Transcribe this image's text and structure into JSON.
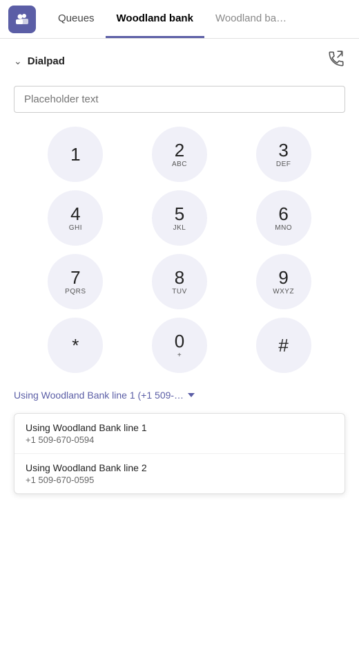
{
  "header": {
    "logo_alt": "Teams logo",
    "tabs": [
      {
        "label": "Queues",
        "active": false
      },
      {
        "label": "Woodland bank",
        "active": true
      },
      {
        "label": "Woodland ba…",
        "active": false,
        "truncated": true
      }
    ]
  },
  "dialpad": {
    "section_label": "Dialpad",
    "toggle_icon": "chevron-down-icon",
    "call_icon": "phone-icon",
    "input_placeholder": "Placeholder text",
    "buttons": [
      {
        "number": "1",
        "letters": ""
      },
      {
        "number": "2",
        "letters": "ABC"
      },
      {
        "number": "3",
        "letters": "DEF"
      },
      {
        "number": "4",
        "letters": "GHI"
      },
      {
        "number": "5",
        "letters": "JKL"
      },
      {
        "number": "6",
        "letters": "MNO"
      },
      {
        "number": "7",
        "letters": "PQRS"
      },
      {
        "number": "8",
        "letters": "TUV"
      },
      {
        "number": "9",
        "letters": "WXYZ"
      },
      {
        "number": "*",
        "letters": ""
      },
      {
        "number": "0",
        "letters": "+"
      },
      {
        "number": "#",
        "letters": ""
      }
    ]
  },
  "line_selector": {
    "selected_label": "Using Woodland Bank line 1 (+1 509-…",
    "dropdown_arrow": "▾",
    "options": [
      {
        "title": "Using Woodland Bank line 1",
        "subtitle": "+1 509-670-0594"
      },
      {
        "title": "Using Woodland Bank line 2",
        "subtitle": "+1 509-670-0595"
      }
    ]
  }
}
